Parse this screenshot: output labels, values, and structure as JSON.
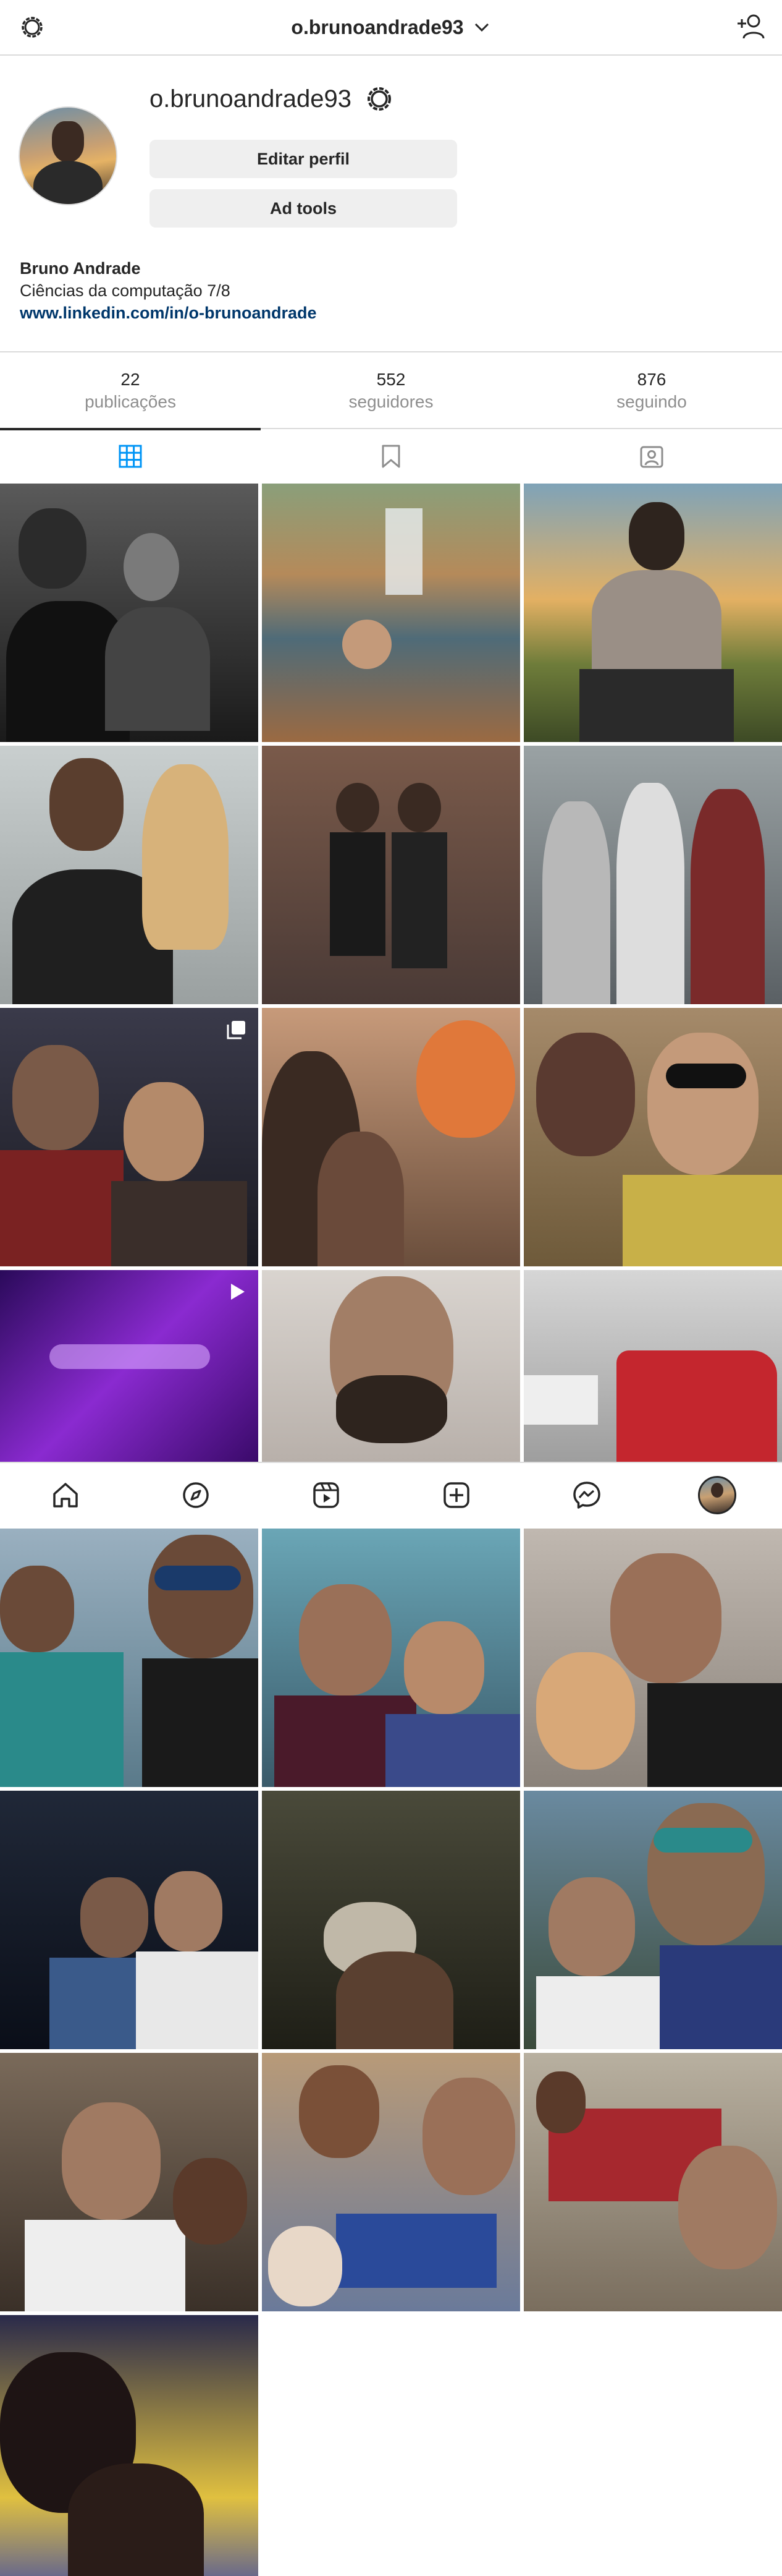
{
  "topbar": {
    "username": "o.brunoandrade93",
    "icons": {
      "left": "gear-icon",
      "dropdown": "chevron-down-icon",
      "right": "add-person-icon"
    }
  },
  "profile": {
    "username": "o.brunoandrade93",
    "edit_button": "Editar perfil",
    "ad_tools_button": "Ad tools",
    "full_name": "Bruno Andrade",
    "bio_line": "Ciências da computação 7/8",
    "link": "www.linkedin.com/in/o-brunoandrade"
  },
  "stats": [
    {
      "value": "22",
      "label": "publicações"
    },
    {
      "value": "552",
      "label": "seguidores"
    },
    {
      "value": "876",
      "label": "seguindo"
    }
  ],
  "tabs": [
    {
      "icon": "grid-icon",
      "active": true
    },
    {
      "icon": "bookmark-icon",
      "active": false
    },
    {
      "icon": "tagged-person-icon",
      "active": false
    }
  ],
  "bottom_nav": [
    {
      "icon": "home-icon"
    },
    {
      "icon": "explore-compass-icon"
    },
    {
      "icon": "reels-icon"
    },
    {
      "icon": "create-plus-icon"
    },
    {
      "icon": "messenger-icon"
    },
    {
      "icon": "profile-avatar-icon"
    }
  ],
  "colors": {
    "link": "#00376b",
    "muted": "#8e8e8e",
    "active_tab": "#0095f6",
    "button_bg": "#efefef",
    "border": "#dbdbdb"
  }
}
